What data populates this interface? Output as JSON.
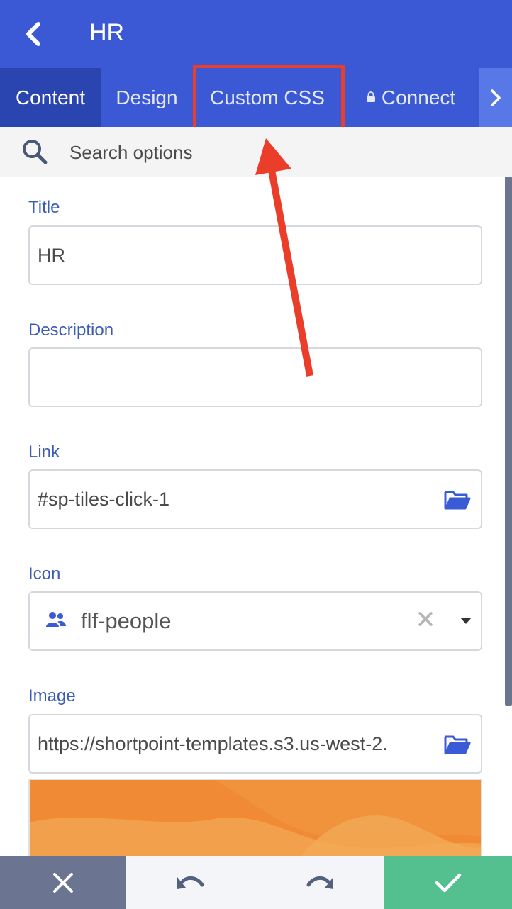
{
  "header": {
    "title": "HR"
  },
  "tabs": [
    {
      "label": "Content",
      "active": true
    },
    {
      "label": "Design",
      "active": false
    },
    {
      "label": "Custom CSS",
      "active": false
    },
    {
      "label": "Connect",
      "active": false,
      "icon": "lock-icon"
    }
  ],
  "search": {
    "placeholder": "Search options",
    "icon": "search-icon"
  },
  "form": {
    "title": {
      "label": "Title",
      "value": "HR"
    },
    "description": {
      "label": "Description",
      "value": ""
    },
    "link": {
      "label": "Link",
      "value": "#sp-tiles-click-1",
      "icon": "folder-icon"
    },
    "icon": {
      "label": "Icon",
      "value": "flf-people",
      "icon": "people-icon"
    },
    "image": {
      "label": "Image",
      "value": "https://shortpoint-templates.s3.us-west-2.",
      "icon": "folder-icon"
    }
  },
  "footer": {
    "cancel_icon": "close-icon",
    "undo_icon": "undo-icon",
    "redo_icon": "redo-icon",
    "save_icon": "check-icon"
  },
  "colors": {
    "header_bg": "#3b59d4",
    "active_tab_bg": "#2b45b0",
    "label": "#3b5bb8",
    "annotation": "#ea3e2a",
    "save": "#55c08f",
    "cancel": "#6b7591"
  }
}
